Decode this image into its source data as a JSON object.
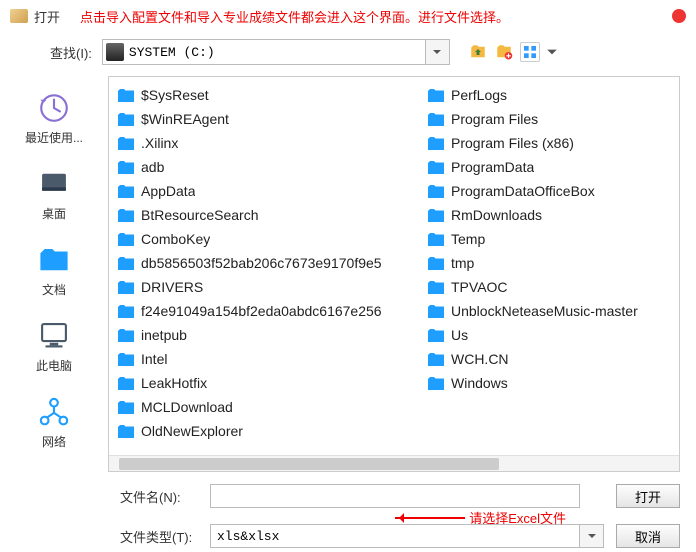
{
  "titlebar": {
    "text": "打开",
    "annotation": "点击导入配置文件和导入专业成绩文件都会进入这个界面。进行文件选择。"
  },
  "searchbar": {
    "label": "查找(I):",
    "drive": "SYSTEM (C:)"
  },
  "sidebar": [
    {
      "id": "recent",
      "label": "最近使用..."
    },
    {
      "id": "desktop",
      "label": "桌面"
    },
    {
      "id": "documents",
      "label": "文档"
    },
    {
      "id": "computer",
      "label": "此电脑"
    },
    {
      "id": "network",
      "label": "网络"
    }
  ],
  "files": [
    "$SysReset",
    "$WinREAgent",
    ".Xilinx",
    "adb",
    "AppData",
    "BtResourceSearch",
    "ComboKey",
    "db5856503f52bab206c7673e9170f9e5",
    "DRIVERS",
    "f24e91049a154bf2eda0abdc6167e256",
    "inetpub",
    "Intel",
    "LeakHotfix",
    "MCLDownload",
    "OldNewExplorer",
    "PerfLogs",
    "Program Files",
    "Program Files (x86)",
    "ProgramData",
    "ProgramDataOfficeBox",
    "RmDownloads",
    "Temp",
    "tmp",
    "TPVAOC",
    "UnblockNeteaseMusic-master",
    "Us",
    "WCH.CN",
    "Windows"
  ],
  "form": {
    "filename_label": "文件名(N):",
    "filename_value": "",
    "filetype_label": "文件类型(T):",
    "filetype_value": "xls&xlsx",
    "open_btn": "打开",
    "cancel_btn": "取消",
    "annotation": "请选择Excel文件"
  }
}
